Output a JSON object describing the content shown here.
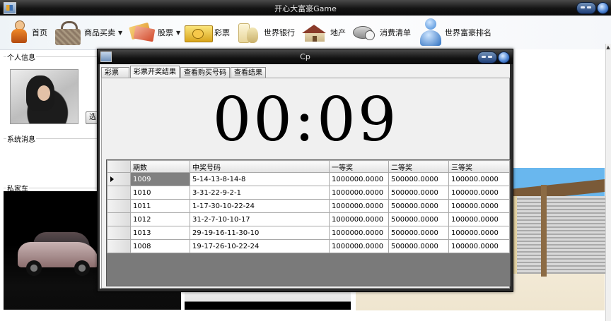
{
  "app": {
    "title": "开心大富豪Game"
  },
  "toolbar": {
    "items": [
      {
        "label": "首页",
        "icon": "home-person-icon",
        "has_menu": false
      },
      {
        "label": "商品买卖",
        "icon": "handbag-icon",
        "has_menu": true
      },
      {
        "label": "股票",
        "icon": "credit-card-icon",
        "has_menu": true
      },
      {
        "label": "彩票",
        "icon": "lottery-ticket-icon",
        "has_menu": false
      },
      {
        "label": "世界银行",
        "icon": "money-bag-icon",
        "has_menu": false
      },
      {
        "label": "地产",
        "icon": "house-icon",
        "has_menu": false
      },
      {
        "label": "消费清单",
        "icon": "shopping-list-icon",
        "has_menu": false
      },
      {
        "label": "世界富豪排名",
        "icon": "user-rank-icon",
        "has_menu": false
      }
    ]
  },
  "panels": {
    "personal": {
      "label": "个人信息",
      "button": "选"
    },
    "messages": {
      "label": "系统消息"
    },
    "car": {
      "label": "私家车"
    }
  },
  "dialog": {
    "title": "Cp",
    "tabs": [
      "彩票",
      "彩票开奖结果",
      "查看购买号码",
      "查看结果"
    ],
    "active_tab": "彩票开奖结果",
    "countdown": "00:09"
  },
  "results_table": {
    "headers": [
      "期数",
      "中奖号码",
      "一等奖",
      "二等奖",
      "三等奖"
    ],
    "rows": [
      [
        "1009",
        "5-14-13-8-14-8",
        "1000000.0000",
        "500000.0000",
        "100000.0000"
      ],
      [
        "1010",
        "3-31-22-9-2-1",
        "1000000.0000",
        "500000.0000",
        "100000.0000"
      ],
      [
        "1011",
        "1-17-30-10-22-24",
        "1000000.0000",
        "500000.0000",
        "100000.0000"
      ],
      [
        "1012",
        "31-2-7-10-10-17",
        "1000000.0000",
        "500000.0000",
        "100000.0000"
      ],
      [
        "1013",
        "29-19-16-11-30-10",
        "1000000.0000",
        "500000.0000",
        "100000.0000"
      ],
      [
        "1008",
        "19-17-26-10-22-24",
        "1000000.0000",
        "500000.0000",
        "100000.0000"
      ]
    ],
    "selected_row": 0
  }
}
